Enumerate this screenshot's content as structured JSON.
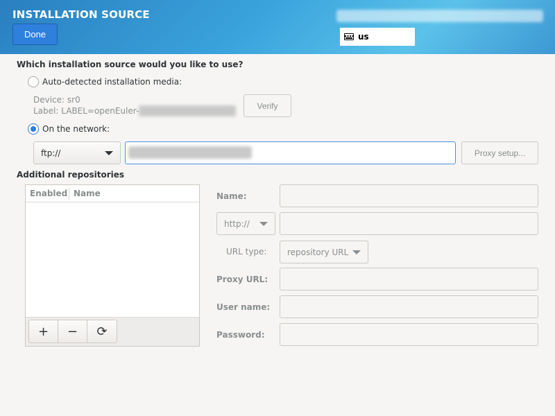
{
  "header": {
    "title": "INSTALLATION SOURCE",
    "done_label": "Done",
    "keyboard_layout": "us"
  },
  "source": {
    "question": "Which installation source would you like to use?",
    "auto_option": "Auto-detected installation media:",
    "device_label": "Device: sr0",
    "label_prefix": "Label: LABEL=openEuler-",
    "verify_label": "Verify",
    "network_option": "On the network:",
    "protocol": "ftp://",
    "proxy_label": "Proxy setup..."
  },
  "repos": {
    "section_title": "Additional repositories",
    "col_enabled": "Enabled",
    "col_name": "Name",
    "add_glyph": "+",
    "remove_glyph": "−",
    "refresh_glyph": "⟳",
    "name_label": "Name:",
    "protocol": "http://",
    "url_type_label": "URL type:",
    "url_type_value": "repository URL",
    "proxy_url_label": "Proxy URL:",
    "user_name_label": "User name:",
    "password_label": "Password:"
  },
  "icons": {
    "keyboard": "keyboard-icon",
    "add": "plus-icon",
    "remove": "minus-icon",
    "refresh": "refresh-icon",
    "dropdown": "chevron-down-icon"
  },
  "colors": {
    "accent": "#2f7fdc",
    "header_gradient_start": "#2a7fc0",
    "background": "#f6f5f4"
  }
}
